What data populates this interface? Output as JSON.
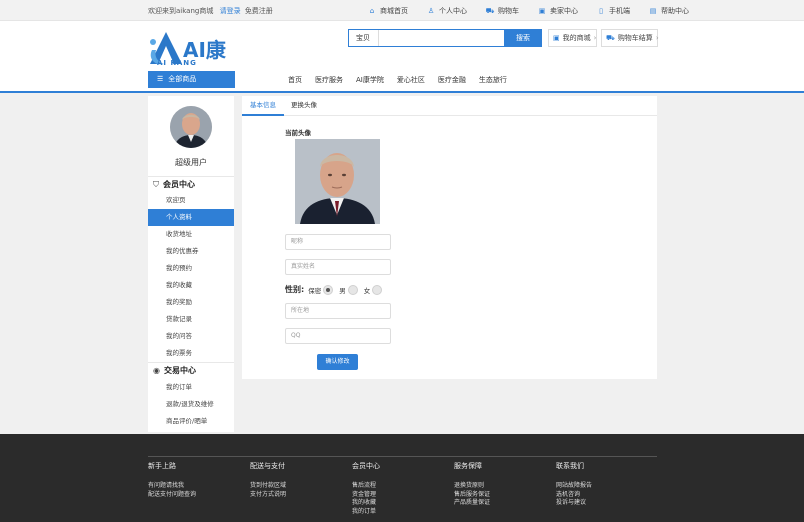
{
  "topbar": {
    "welcome": "欢迎来到aikang商城",
    "login": "请登录",
    "register": "免费注册",
    "links": [
      {
        "icon": "home-icon",
        "label": "商城首页"
      },
      {
        "icon": "user-icon",
        "label": "个人中心"
      },
      {
        "icon": "cart-icon",
        "label": "购物车"
      },
      {
        "icon": "seller-icon",
        "label": "卖家中心"
      },
      {
        "icon": "phone-icon",
        "label": "手机端"
      },
      {
        "icon": "help-icon",
        "label": "帮助中心"
      }
    ]
  },
  "brand": {
    "name": "AI康",
    "sub": "AI KANG",
    "color": "#2f7fd6"
  },
  "search": {
    "category": "宝贝",
    "button": "搜索",
    "value": ""
  },
  "header_buttons": {
    "my_shop": "我的商城",
    "cart_checkout": "购物车结算"
  },
  "all_categories": "全部商品",
  "nav": [
    "首页",
    "医疗服务",
    "AI康学院",
    "爱心社区",
    "医疗金融",
    "生态旅行"
  ],
  "sidebar": {
    "username": "超级用户",
    "member_center": "会员中心",
    "member_items": [
      "欢迎页",
      "个人资料",
      "收货地址",
      "我的优惠券",
      "我的预约",
      "我的收藏",
      "我的奖励",
      "贷款记录",
      "我的问答",
      "我的票务"
    ],
    "active_index": 1,
    "trade_center": "交易中心",
    "trade_items": [
      "我的订单",
      "退款/退货及维修",
      "商品评价/晒单"
    ]
  },
  "profile": {
    "tabs": [
      "基本信息",
      "更换头像"
    ],
    "active_tab": 0,
    "current_avatar_label": "当前头像",
    "nickname_placeholder": "昵称",
    "realname_placeholder": "真实姓名",
    "gender_label": "性别:",
    "gender_options": [
      "保密",
      "男",
      "女"
    ],
    "gender_selected": 0,
    "location_placeholder": "所在地",
    "qq_placeholder": "QQ",
    "confirm_button": "确认修改"
  },
  "footer": {
    "columns": [
      {
        "title": "新手上路",
        "links": [
          "有问题请找我",
          "配送支付问题查询"
        ]
      },
      {
        "title": "配送与支付",
        "links": [
          "货到付款区域",
          "支付方式说明"
        ]
      },
      {
        "title": "会员中心",
        "links": [
          "售后流程",
          "资金管理",
          "我的收藏",
          "我的订单"
        ]
      },
      {
        "title": "服务保障",
        "links": [
          "退换货原则",
          "售后服务保证",
          "产品质量保证"
        ]
      },
      {
        "title": "联系我们",
        "links": [
          "网站故障报告",
          "选机咨询",
          "投诉与建议"
        ]
      }
    ]
  }
}
